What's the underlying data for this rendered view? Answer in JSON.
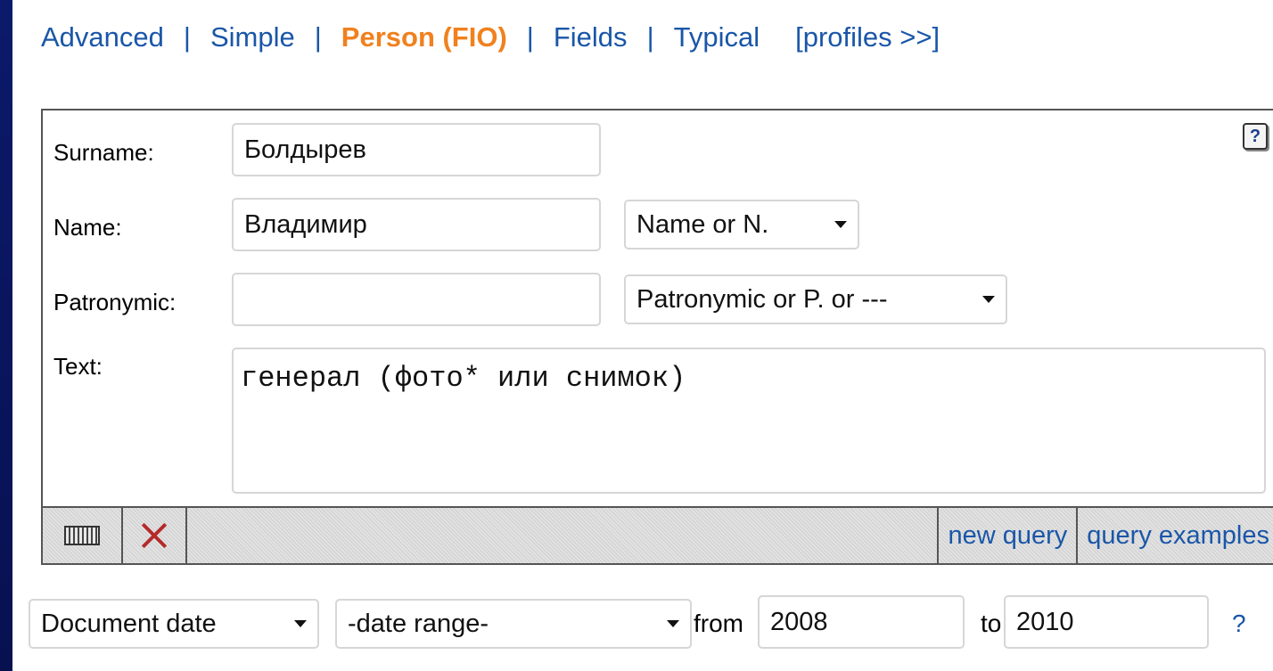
{
  "tabs": {
    "advanced": "Advanced",
    "simple": "Simple",
    "person": "Person (FIO)",
    "fields": "Fields",
    "typical": "Typical",
    "separator": "|",
    "profiles": "[profiles >>]"
  },
  "form": {
    "help_icon": "?",
    "surname_label": "Surname:",
    "surname_value": "Болдырев",
    "name_label": "Name:",
    "name_value": "Владимир",
    "name_mode": "Name or N.",
    "patronymic_label": "Patronymic:",
    "patronymic_value": "",
    "patronymic_mode": "Patronymic or P. or ---",
    "text_label": "Text:",
    "text_value": "генерал (фото* или снимок)"
  },
  "toolbar": {
    "new_query": "new query",
    "query_examples": "query examples"
  },
  "date": {
    "type": "Document date",
    "range": "-date range-",
    "from_label": "from",
    "from_value": "2008",
    "to_label": "to",
    "to_value": "2010",
    "help": "?"
  },
  "colors": {
    "link": "#1a56a8",
    "active_tab": "#f0811e",
    "border": "#0b1a6a"
  }
}
